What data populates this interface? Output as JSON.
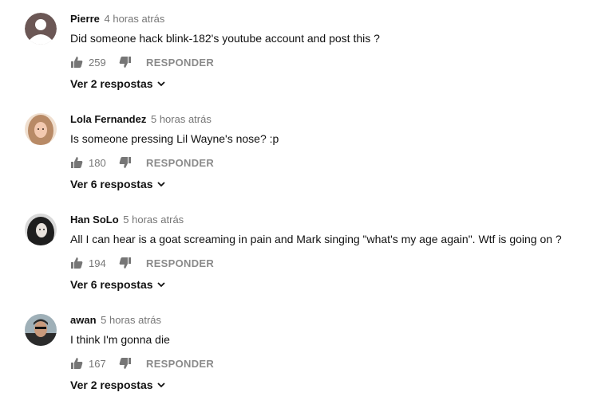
{
  "comments": [
    {
      "author": "Pierre",
      "time": "4 horas atrás",
      "text": "Did someone hack blink-182's youtube account and post this ?",
      "likes": "259",
      "reply_label": "RESPONDER",
      "view_replies": "Ver 2 respostas",
      "avatar": "default-avatar"
    },
    {
      "author": "Lola Fernandez",
      "time": "5 horas atrás",
      "text": "Is someone pressing Lil Wayne's nose? :p",
      "likes": "180",
      "reply_label": "RESPONDER",
      "view_replies": "Ver 6 respostas",
      "avatar": "photo-avatar"
    },
    {
      "author": "Han SoLo",
      "time": "5 horas atrás",
      "text": "All I can hear is a goat screaming in pain and Mark singing \"what's my age again\". Wtf is going on ?",
      "likes": "194",
      "reply_label": "RESPONDER",
      "view_replies": "Ver 6 respostas",
      "avatar": "photo-avatar"
    },
    {
      "author": "awan",
      "time": "5 horas atrás",
      "text": "I think I'm gonna die",
      "likes": "167",
      "reply_label": "RESPONDER",
      "view_replies": "Ver 2 respostas",
      "avatar": "photo-avatar"
    }
  ],
  "icons": {
    "like": "thumbs-up-icon",
    "dislike": "thumbs-down-icon",
    "expand": "chevron-down-icon"
  },
  "colors": {
    "text": "#111111",
    "muted": "#767676",
    "reply": "#8a8a8a",
    "default_avatar": "#6b5755"
  }
}
